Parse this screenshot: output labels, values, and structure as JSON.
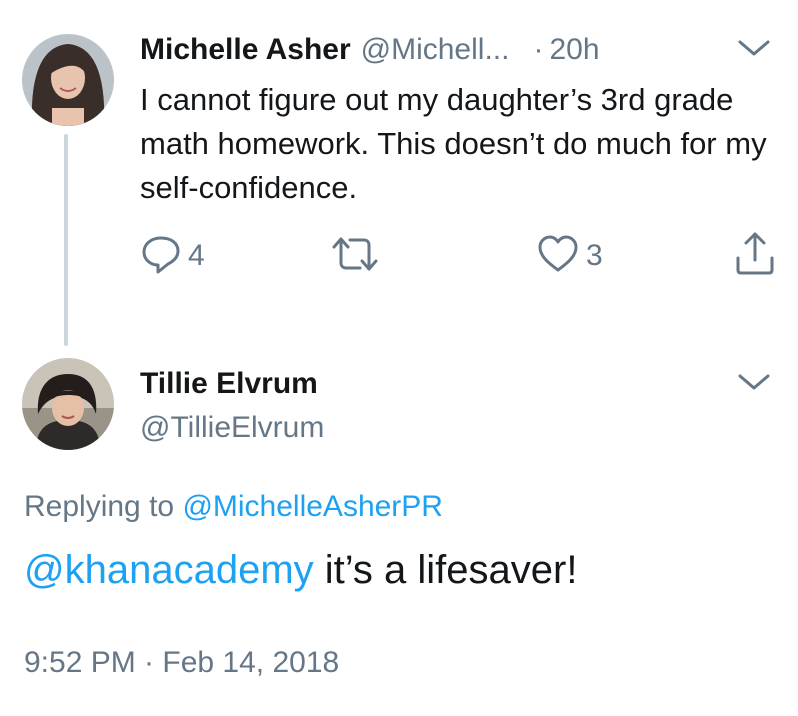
{
  "parent_tweet": {
    "display_name": "Michelle Asher",
    "handle_truncated": "@Michell...",
    "time_separator": "·",
    "time": "20h",
    "text": "I cannot figure out my daughter’s 3rd grade math homework. This doesn’t do much for my self-confidence.",
    "actions": {
      "reply_count": "4",
      "retweet_count": "",
      "like_count": "3"
    }
  },
  "reply_tweet": {
    "display_name": "Tillie Elvrum",
    "handle": "@TillieElvrum",
    "replying_prefix": "Replying to",
    "replying_to": "@MichelleAsherPR",
    "mention": "@khanacademy",
    "text": " it’s a lifesaver!",
    "timestamp": "9:52 PM · Feb 14, 2018"
  },
  "colors": {
    "text": "#14171a",
    "muted": "#657786",
    "link": "#1da1f2",
    "thread_line": "#ccd6dd"
  },
  "icons": {
    "reply": "reply-icon",
    "retweet": "retweet-icon",
    "like": "heart-icon",
    "share": "share-icon",
    "menu": "chevron-down-icon"
  }
}
